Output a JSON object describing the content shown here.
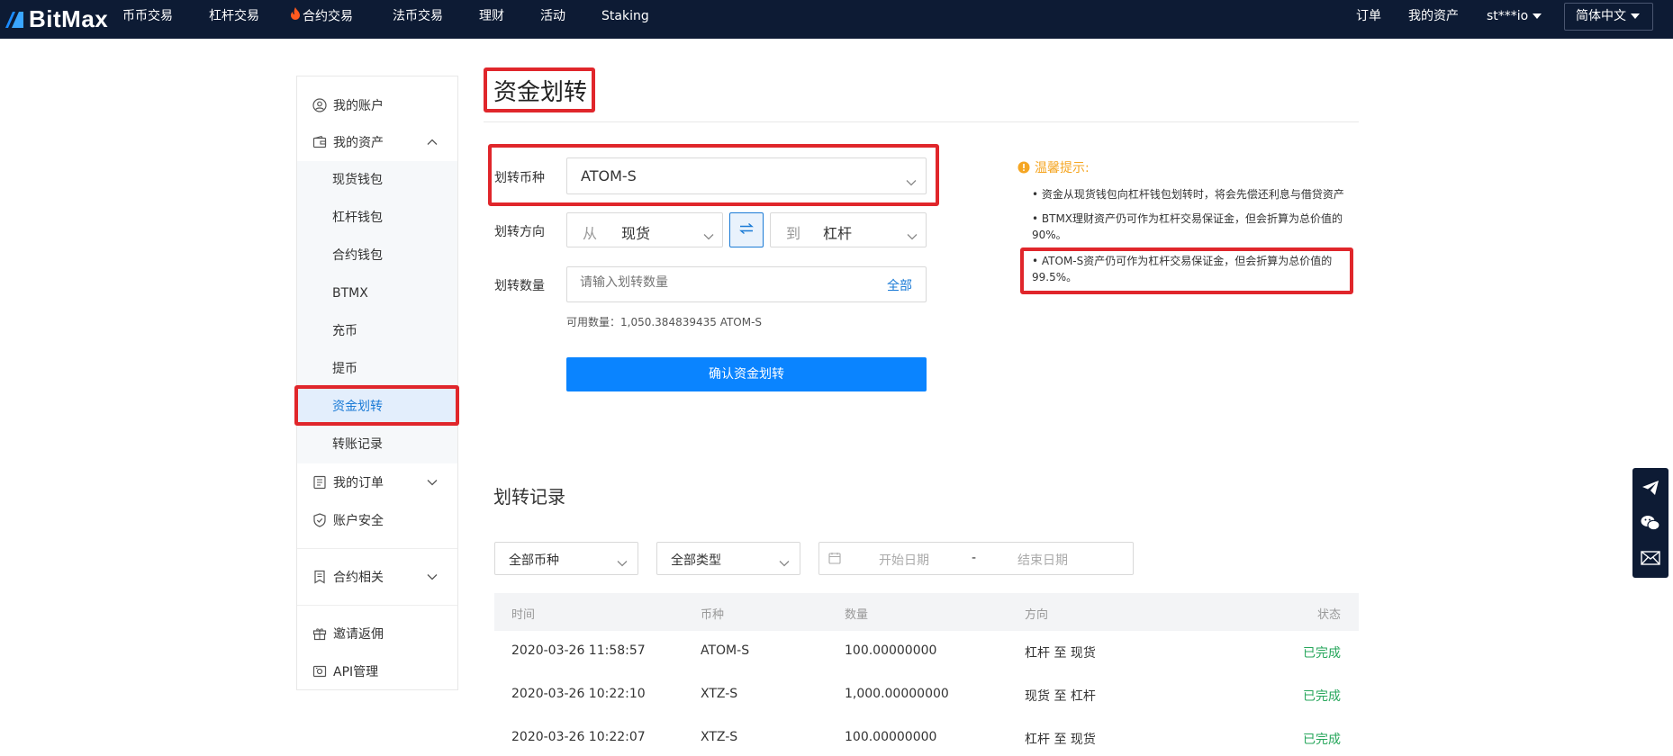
{
  "app": {
    "brand": "BitMax"
  },
  "nav": {
    "items": [
      "币币交易",
      "杠杆交易",
      "合约交易",
      "法币交易",
      "理财",
      "活动",
      "Staking"
    ],
    "right": {
      "orders": "订单",
      "assets": "我的资产",
      "user": "st***io",
      "language": "简体中文"
    }
  },
  "sidebar": {
    "account": "我的账户",
    "assets": "我的资产",
    "asset_subs": [
      "现货钱包",
      "杠杆钱包",
      "合约钱包",
      "BTMX",
      "充币",
      "提币",
      "资金划转",
      "转账记录"
    ],
    "active_sub": "资金划转",
    "orders": "我的订单",
    "security": "账户安全",
    "contract": "合约相关",
    "invite": "邀请返佣",
    "api": "API管理"
  },
  "transfer": {
    "title": "资金划转",
    "coin_label": "划转币种",
    "coin_value": "ATOM-S",
    "direction_label": "划转方向",
    "from_prefix": "从",
    "from_value": "现货",
    "to_prefix": "到",
    "to_value": "杠杆",
    "amount_label": "划转数量",
    "amount_placeholder": "请输入划转数量",
    "all_button": "全部",
    "available": "可用数量：1,050.384839435 ATOM-S",
    "confirm_button": "确认资金划转"
  },
  "tips": {
    "title": "温馨提示:",
    "lines": [
      "• 资金从现货钱包向杠杆钱包划转时，将会先偿还利息与借贷资产",
      "• BTMX理财资产仍可作为杠杆交易保证金，但会折算为总价值的90%。",
      "• ATOM-S资产仍可作为杠杆交易保证金，但会折算为总价值的99.5%。"
    ]
  },
  "records": {
    "title": "划转记录",
    "filters": {
      "coin": "全部币种",
      "type": "全部类型",
      "start_placeholder": "开始日期",
      "separator": "-",
      "end_placeholder": "结束日期"
    },
    "columns": [
      "时间",
      "币种",
      "数量",
      "方向",
      "状态"
    ],
    "rows": [
      {
        "time": "2020-03-26 11:58:57",
        "coin": "ATOM-S",
        "amount": "100.00000000",
        "direction": "杠杆 至 现货",
        "status": "已完成"
      },
      {
        "time": "2020-03-26 10:22:10",
        "coin": "XTZ-S",
        "amount": "1,000.00000000",
        "direction": "现货 至 杠杆",
        "status": "已完成"
      },
      {
        "time": "2020-03-26 10:22:07",
        "coin": "XTZ-S",
        "amount": "100.00000000",
        "direction": "杠杆 至 现货",
        "status": "已完成"
      }
    ]
  },
  "colors": {
    "nav_bg": "#0d1b34",
    "primary": "#0a84ff",
    "highlight_red": "#e0262b",
    "success": "#26a65b",
    "warning": "#f5a623"
  }
}
